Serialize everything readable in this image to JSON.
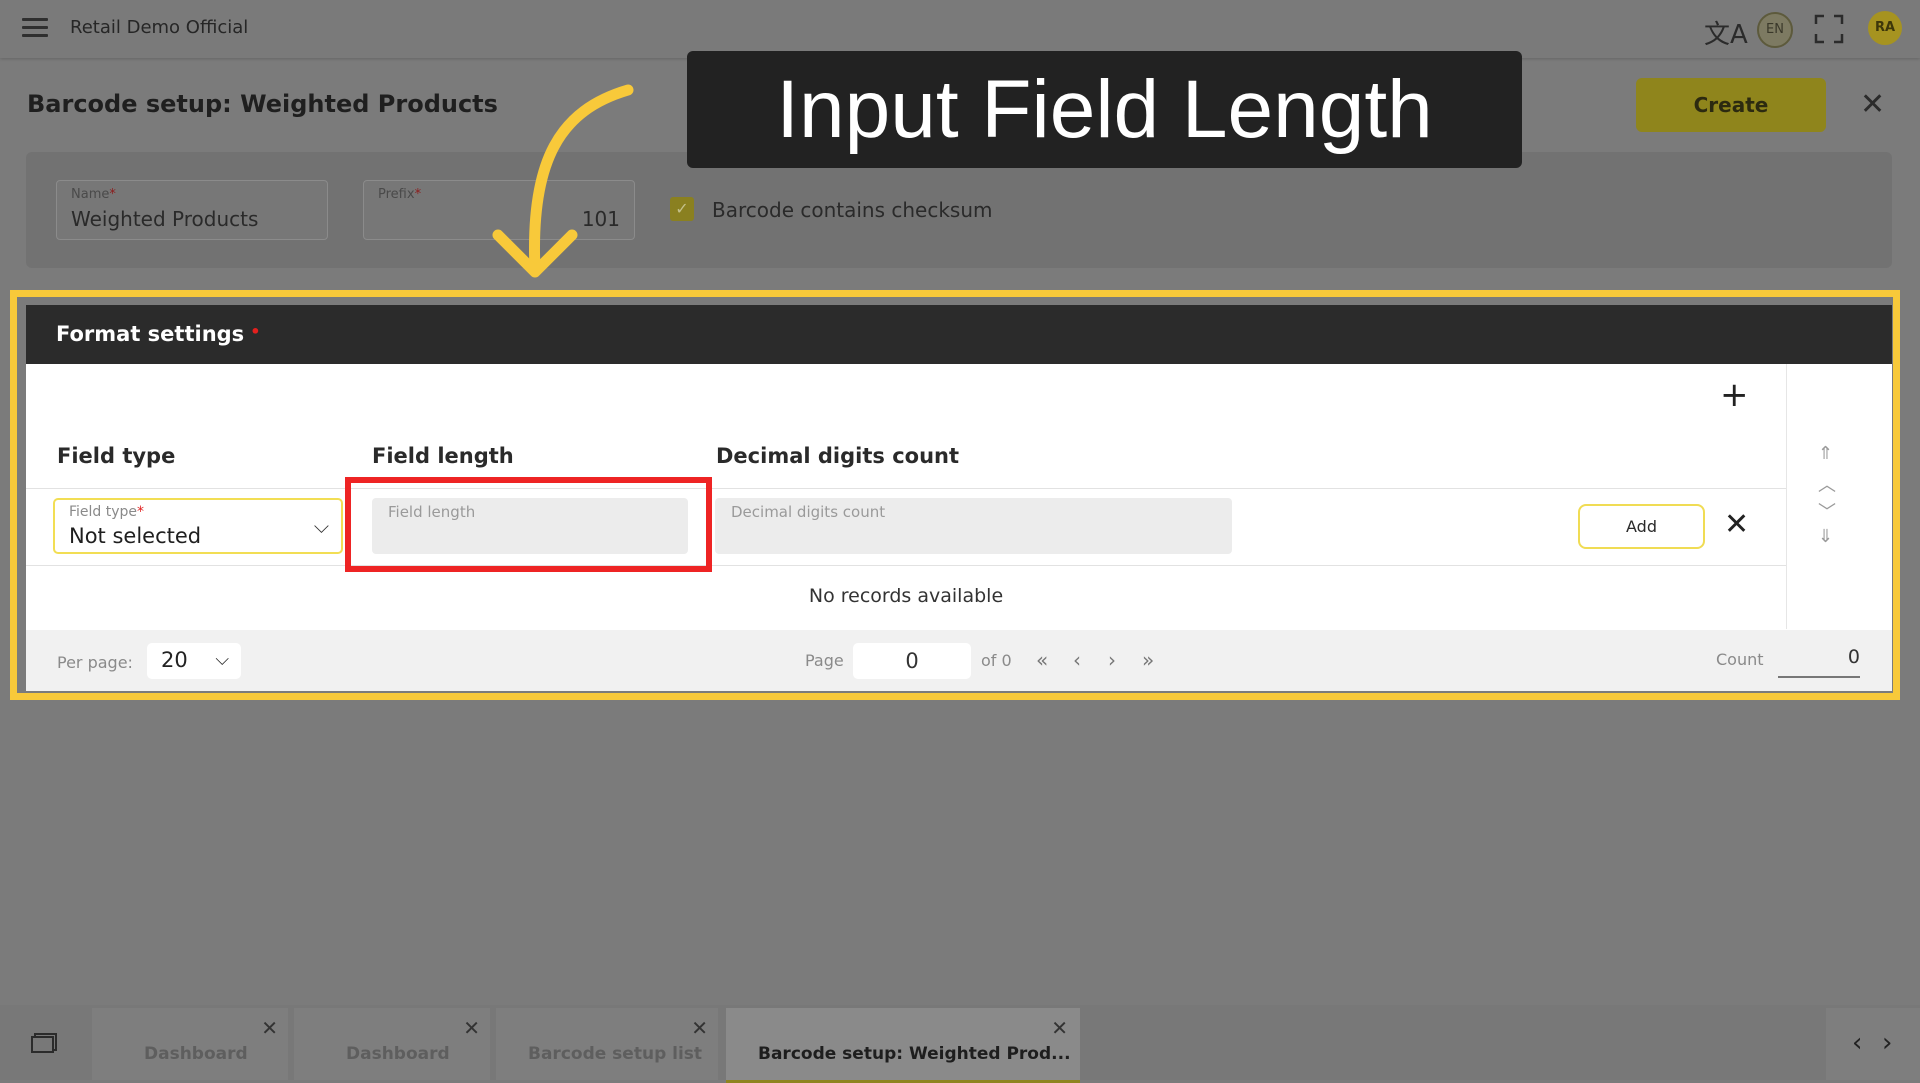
{
  "app": {
    "title": "Retail Demo Official"
  },
  "header": {
    "lang": "EN",
    "avatar": "RA",
    "page_title": "Barcode setup: Weighted Products",
    "create_label": "Create"
  },
  "form": {
    "name": {
      "label": "Name",
      "value": "Weighted Products"
    },
    "prefix": {
      "label": "Prefix",
      "value": "101"
    },
    "checksum": {
      "label": "Barcode contains checksum",
      "checked": true
    }
  },
  "callout": {
    "text": "Input Field Length"
  },
  "format": {
    "title": "Format settings",
    "columns": [
      "Field type",
      "Field length",
      "Decimal digits count"
    ],
    "field_type": {
      "label": "Field type",
      "value": "Not selected"
    },
    "field_length": {
      "placeholder": "Field length"
    },
    "decimal_digits": {
      "placeholder": "Decimal digits count"
    },
    "add_label": "Add",
    "empty_text": "No records available"
  },
  "pager": {
    "per_page_label": "Per page:",
    "per_page_value": "20",
    "page_label": "Page",
    "page_value": "0",
    "of_label": "of 0",
    "count_label": "Count",
    "count_value": "0"
  },
  "tabs": [
    {
      "label": "Dashboard",
      "active": false
    },
    {
      "label": "Dashboard",
      "active": false
    },
    {
      "label": "Barcode setup list",
      "active": false
    },
    {
      "label": "Barcode setup: Weighted Prod...",
      "active": true
    }
  ],
  "colors": {
    "accent": "#f8c93a",
    "highlight_red": "#ee2424",
    "header_dark": "#2b2b2b"
  }
}
